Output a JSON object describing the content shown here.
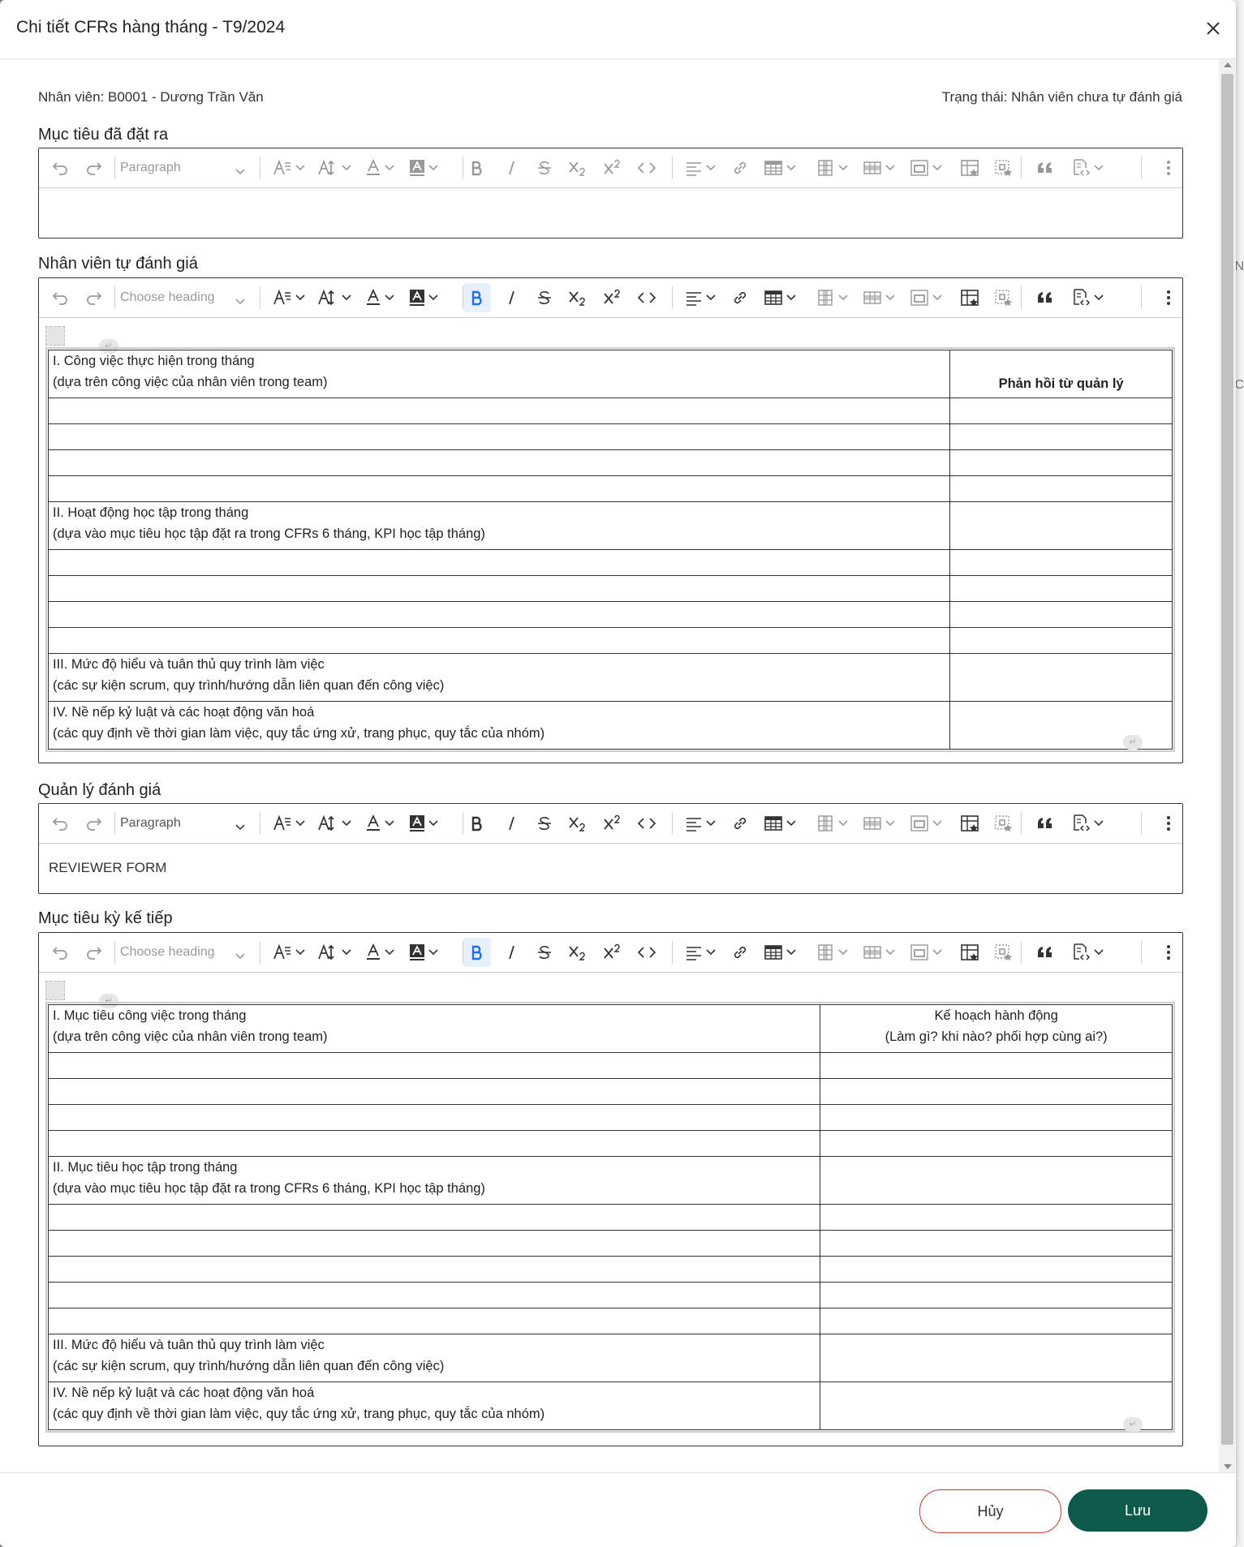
{
  "modal": {
    "title": "Chi tiết CFRs hàng tháng - T9/2024"
  },
  "employee": "Nhân viên: B0001 - Dương Trần Văn",
  "status": "Trạng thái: Nhân viên chưa tự đánh giá",
  "sections": {
    "goals": {
      "label": "Mục tiêu đã đặt ra",
      "heading": "Paragraph",
      "content": ""
    },
    "self_review": {
      "label": "Nhân viên tự đánh giá",
      "heading": "Choose heading",
      "table": {
        "header_left": [
          "I. Công việc thực hiện trong tháng",
          "(dựa trên công việc của nhân viên trong team)"
        ],
        "header_right": "Phản hồi từ quản lý",
        "sec2": [
          "II. Hoạt động học tập trong tháng",
          "(dựa vào mục tiêu học tập đặt ra trong CFRs 6 tháng, KPI học tập tháng)"
        ],
        "sec3": [
          "III. Mức độ hiểu và tuân thủ quy trình làm việc",
          "(các sự kiện scrum, quy trình/hướng dẫn liên quan đến công việc)"
        ],
        "sec4": [
          "IV. Nề nếp kỷ luật và các hoạt động văn hoá",
          "(các quy định về thời gian làm việc, quy tắc ứng xử, trang phục, quy tắc của nhóm)"
        ]
      }
    },
    "manager_review": {
      "label": "Quản lý đánh giá",
      "heading": "Paragraph",
      "content": "REVIEWER FORM"
    },
    "next_goals": {
      "label": "Mục tiêu kỳ kế tiếp",
      "heading": "Choose heading",
      "table": {
        "header_left": [
          "I. Mục tiêu công việc trong tháng",
          "(dựa trên công việc của nhân viên trong team)"
        ],
        "header_right": [
          "Kế hoạch hành động",
          "(Làm gì? khi nào? phối hợp cùng ai?)"
        ],
        "sec2": [
          "II. Mục tiêu học tập trong tháng",
          "(dựa vào mục tiêu học tập đặt ra trong CFRs 6 tháng, KPI học tập tháng)"
        ],
        "sec3": [
          "III. Mức độ hiểu và tuân thủ quy trình làm việc",
          "(các sự kiện scrum, quy trình/hướng dẫn liên quan đến công việc)"
        ],
        "sec4": [
          "IV. Nề nếp kỷ luật và các hoạt động văn hoá",
          "(các quy định về thời gian làm việc, quy tắc ứng xử, trang phục, quy tắc của nhóm)"
        ]
      }
    }
  },
  "toolbar_icons": [
    "undo-icon",
    "redo-icon",
    "heading-select",
    "font-family-icon",
    "font-size-icon",
    "font-color-icon",
    "font-background-icon",
    "bold-icon",
    "italic-icon",
    "strikethrough-icon",
    "subscript-icon",
    "superscript-icon",
    "code-icon",
    "align-icon",
    "link-icon",
    "insert-table-icon",
    "table-column-icon",
    "table-row-icon",
    "merge-cells-icon",
    "table-properties-icon",
    "cell-properties-icon",
    "blockquote-icon",
    "source-editing-icon",
    "more-icon"
  ],
  "buttons": {
    "cancel": "Hủy",
    "save": "Lưu"
  },
  "colors": {
    "primary": "#0e5a4a",
    "cancel_border": "#c0392b",
    "active_bold": "#1a73e8"
  }
}
